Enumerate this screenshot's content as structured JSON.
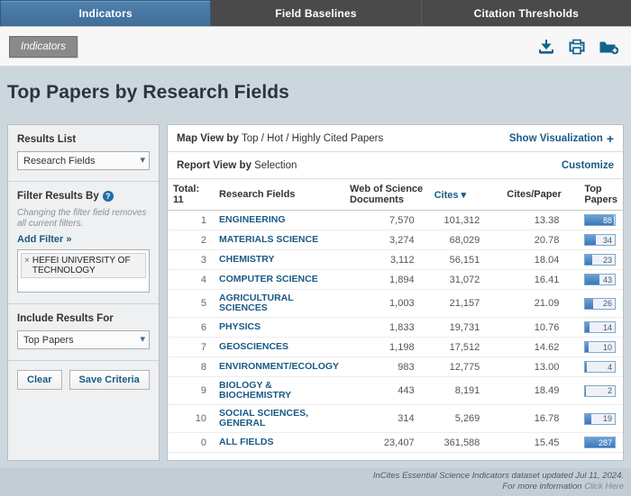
{
  "tabs": [
    {
      "label": "Indicators",
      "active": true
    },
    {
      "label": "Field Baselines",
      "active": false
    },
    {
      "label": "Citation Thresholds",
      "active": false
    }
  ],
  "breadcrumb": "Indicators",
  "toolbar": {
    "download_icon": "download-icon",
    "print_icon": "print-icon",
    "add_folder_icon": "add-to-folder-icon"
  },
  "page_title": "Top Papers by Research Fields",
  "sidebar": {
    "results_list_label": "Results List",
    "results_list_value": "Research Fields",
    "filter_label": "Filter Results By",
    "filter_help_glyph": "?",
    "filter_hint": "Changing the filter field removes all current filters.",
    "add_filter_label": "Add Filter »",
    "filter_chips": [
      {
        "remove_glyph": "×",
        "label": "HEFEI UNIVERSITY OF TECHNOLOGY"
      }
    ],
    "include_label": "Include Results For",
    "include_value": "Top Papers",
    "clear_label": "Clear",
    "save_label": "Save Criteria"
  },
  "main": {
    "map_view_label": "Map View by",
    "map_view_value": "Top / Hot / Highly Cited Papers",
    "show_visualization_label": "Show Visualization",
    "show_visualization_plus": "+",
    "report_view_label": "Report View by",
    "report_view_value": "Selection",
    "customize_label": "Customize",
    "sort_caret": "▾"
  },
  "chart_data": {
    "type": "table",
    "title": "Top Papers by Research Fields",
    "total_label": "Total:",
    "total_value": "11",
    "columns": [
      "Research Fields",
      "Web of Science Documents",
      "Cites",
      "Cites/Paper",
      "Top Papers"
    ],
    "top_papers_max": 287,
    "rows": [
      {
        "rank": "1",
        "field": "ENGINEERING",
        "wos": "7,570",
        "cites": "101,312",
        "cites_per_paper": "13.38",
        "top_papers": 88,
        "bar_pct": 97
      },
      {
        "rank": "2",
        "field": "MATERIALS SCIENCE",
        "wos": "3,274",
        "cites": "68,029",
        "cites_per_paper": "20.78",
        "top_papers": 34,
        "bar_pct": 37
      },
      {
        "rank": "3",
        "field": "CHEMISTRY",
        "wos": "3,112",
        "cites": "56,151",
        "cites_per_paper": "18.04",
        "top_papers": 23,
        "bar_pct": 25
      },
      {
        "rank": "4",
        "field": "COMPUTER SCIENCE",
        "wos": "1,894",
        "cites": "31,072",
        "cites_per_paper": "16.41",
        "top_papers": 43,
        "bar_pct": 47
      },
      {
        "rank": "5",
        "field": "AGRICULTURAL SCIENCES",
        "wos": "1,003",
        "cites": "21,157",
        "cites_per_paper": "21.09",
        "top_papers": 26,
        "bar_pct": 28
      },
      {
        "rank": "6",
        "field": "PHYSICS",
        "wos": "1,833",
        "cites": "19,731",
        "cites_per_paper": "10.76",
        "top_papers": 14,
        "bar_pct": 15
      },
      {
        "rank": "7",
        "field": "GEOSCIENCES",
        "wos": "1,198",
        "cites": "17,512",
        "cites_per_paper": "14.62",
        "top_papers": 10,
        "bar_pct": 11
      },
      {
        "rank": "8",
        "field": "ENVIRONMENT/ECOLOGY",
        "wos": "983",
        "cites": "12,775",
        "cites_per_paper": "13.00",
        "top_papers": 4,
        "bar_pct": 5
      },
      {
        "rank": "9",
        "field": "BIOLOGY & BIOCHEMISTRY",
        "wos": "443",
        "cites": "8,191",
        "cites_per_paper": "18.49",
        "top_papers": 2,
        "bar_pct": 2
      },
      {
        "rank": "10",
        "field": "SOCIAL SCIENCES, GENERAL",
        "wos": "314",
        "cites": "5,269",
        "cites_per_paper": "16.78",
        "top_papers": 19,
        "bar_pct": 21
      },
      {
        "rank": "0",
        "field": "ALL FIELDS",
        "wos": "23,407",
        "cites": "361,588",
        "cites_per_paper": "15.45",
        "top_papers": 287,
        "bar_pct": 100
      }
    ]
  },
  "footer": {
    "line1": "InCites Essential Science Indicators dataset updated Jul 11, 2024.",
    "line2_prefix": "For more information ",
    "line2_link": "Click Here"
  }
}
